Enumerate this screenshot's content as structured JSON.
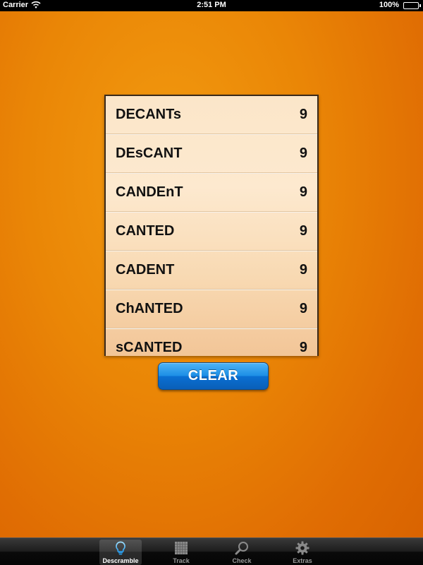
{
  "status_bar": {
    "carrier": "Carrier",
    "time": "2:51 PM",
    "battery": "100%"
  },
  "word_list": {
    "rows": [
      {
        "word": "DECANTs",
        "score": "9"
      },
      {
        "word": "DEsCANT",
        "score": "9"
      },
      {
        "word": "CANDEnT",
        "score": "9"
      },
      {
        "word": "CANTED",
        "score": "9"
      },
      {
        "word": "CADENT",
        "score": "9"
      },
      {
        "word": "ChANTED",
        "score": "9"
      },
      {
        "word": "sCANTED",
        "score": "9"
      }
    ]
  },
  "clear_button": {
    "label": "CLEAR"
  },
  "tab_bar": {
    "tabs": [
      {
        "label": "Descramble",
        "icon": "bulb-icon",
        "active": true
      },
      {
        "label": "Track",
        "icon": "grid-icon",
        "active": false
      },
      {
        "label": "Check",
        "icon": "magnifier-icon",
        "active": false
      },
      {
        "label": "Extras",
        "icon": "gear-icon",
        "active": false
      }
    ]
  },
  "colors": {
    "background": "#e97f05",
    "button": "#1d8fe6",
    "list": "#fde9cf"
  }
}
